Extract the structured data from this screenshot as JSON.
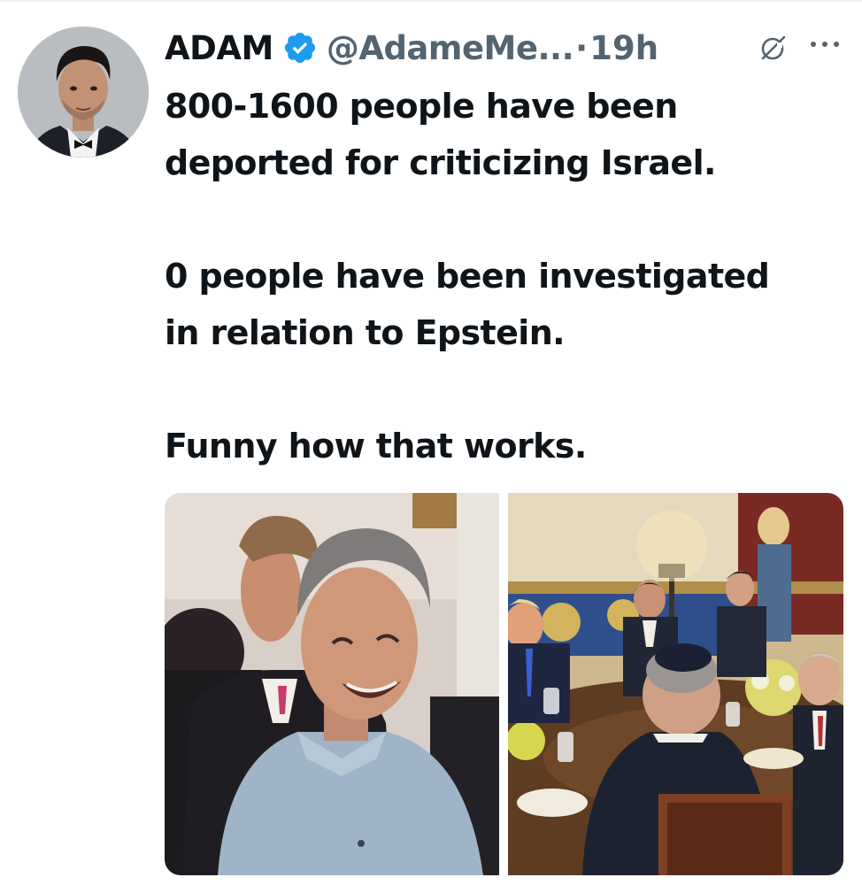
{
  "tweet": {
    "author": {
      "display_name": "ADAM",
      "handle": "@AdameMe...",
      "verified": true,
      "avatar_icon": "profile-photo"
    },
    "separator": "·",
    "time": "19h",
    "lines": [
      "800-1600 people have been",
      "deported for criticizing Israel.",
      "",
      "0 people have been investigated",
      "in relation to Epstein.",
      "",
      "Funny how that works."
    ],
    "media": [
      {
        "icon": "photo-two-men-laughing"
      },
      {
        "icon": "photo-formal-dinner-meeting"
      }
    ]
  },
  "colors": {
    "text": "#0f1419",
    "secondary": "#536471",
    "verified_blue": "#1d9bf0"
  },
  "icons": {
    "verified": "verified-badge-icon",
    "grok": "grok-icon",
    "more": "more-options-icon"
  }
}
